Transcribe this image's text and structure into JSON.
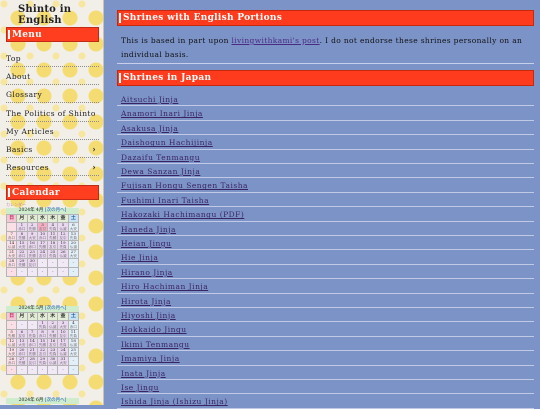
{
  "site": {
    "title": "Shinto in English"
  },
  "sidebar": {
    "menu_heading": "Menu",
    "items": [
      {
        "label": "Top"
      },
      {
        "label": "About"
      },
      {
        "label": "Glossary"
      },
      {
        "label": "The Politics of Shinto"
      },
      {
        "label": "My Articles"
      },
      {
        "label": "Basics",
        "has_submenu": true
      },
      {
        "label": "Resources",
        "has_submenu": true
      }
    ],
    "submenu_indicator": "›",
    "calendar_heading": "Calendar"
  },
  "calendar": {
    "caption": "カレンダー",
    "weekdays": [
      "日",
      "月",
      "火",
      "水",
      "木",
      "金",
      "土"
    ],
    "months": [
      {
        "title": "2024年 4月",
        "next_link": "[次の月へ]",
        "weeks": [
          [
            {
              "n": ""
            },
            {
              "n": "1",
              "s": "赤口"
            },
            {
              "n": "2",
              "s": "先勝"
            },
            {
              "n": "3",
              "s": "友引"
            },
            {
              "n": "4",
              "s": "先負"
            },
            {
              "n": "5",
              "s": "仏滅"
            },
            {
              "n": "6",
              "s": "大安"
            }
          ],
          [
            {
              "n": "7",
              "s": "赤口"
            },
            {
              "n": "8",
              "s": "先勝"
            },
            {
              "n": "9",
              "s": "大安"
            },
            {
              "n": "10",
              "s": "赤口"
            },
            {
              "n": "11",
              "s": "先勝"
            },
            {
              "n": "12",
              "s": "友引"
            },
            {
              "n": "13",
              "s": "先負"
            }
          ],
          [
            {
              "n": "14",
              "s": "仏滅"
            },
            {
              "n": "15",
              "s": "大安"
            },
            {
              "n": "16",
              "s": "赤口"
            },
            {
              "n": "17",
              "s": "先勝"
            },
            {
              "n": "18",
              "s": "友引"
            },
            {
              "n": "19",
              "s": "先負"
            },
            {
              "n": "20",
              "s": "仏滅"
            }
          ],
          [
            {
              "n": "21",
              "s": "大安"
            },
            {
              "n": "22",
              "s": "赤口"
            },
            {
              "n": "23",
              "s": "先勝"
            },
            {
              "n": "24",
              "s": "友引"
            },
            {
              "n": "25",
              "s": "先負"
            },
            {
              "n": "26",
              "s": "仏滅"
            },
            {
              "n": "27",
              "s": "大安"
            }
          ],
          [
            {
              "n": "28",
              "s": "赤口"
            },
            {
              "n": "29",
              "s": "先勝"
            },
            {
              "n": "30",
              "s": "友引"
            },
            {
              "n": "-"
            },
            {
              "n": "-"
            },
            {
              "n": "-"
            },
            {
              "n": "-"
            }
          ],
          [
            {
              "n": "-"
            },
            {
              "n": "-"
            },
            {
              "n": "-"
            },
            {
              "n": "-"
            },
            {
              "n": "-"
            },
            {
              "n": "-"
            },
            {
              "n": "-"
            }
          ]
        ]
      },
      {
        "title": "2024年 5月",
        "next_link": "[次の月へ]",
        "weeks": [
          [
            {
              "n": "-"
            },
            {
              "n": "-"
            },
            {
              "n": "-"
            },
            {
              "n": "1",
              "s": "先負"
            },
            {
              "n": "2",
              "s": "仏滅"
            },
            {
              "n": "3",
              "s": "大安"
            },
            {
              "n": "4",
              "s": "赤口"
            }
          ],
          [
            {
              "n": "5",
              "s": "先勝"
            },
            {
              "n": "6",
              "s": "友引"
            },
            {
              "n": "7",
              "s": "先負"
            },
            {
              "n": "8",
              "s": "赤口"
            },
            {
              "n": "9",
              "s": "先勝"
            },
            {
              "n": "10",
              "s": "友引"
            },
            {
              "n": "11",
              "s": "先負"
            }
          ],
          [
            {
              "n": "12",
              "s": "仏滅"
            },
            {
              "n": "13",
              "s": "大安"
            },
            {
              "n": "14",
              "s": "赤口"
            },
            {
              "n": "15",
              "s": "先勝"
            },
            {
              "n": "16",
              "s": "友引"
            },
            {
              "n": "17",
              "s": "先負"
            },
            {
              "n": "18",
              "s": "仏滅"
            }
          ],
          [
            {
              "n": "19",
              "s": "大安"
            },
            {
              "n": "20",
              "s": "赤口"
            },
            {
              "n": "21",
              "s": "先勝"
            },
            {
              "n": "22",
              "s": "友引"
            },
            {
              "n": "23",
              "s": "先負"
            },
            {
              "n": "24",
              "s": "仏滅"
            },
            {
              "n": "25",
              "s": "大安"
            }
          ],
          [
            {
              "n": "26",
              "s": "赤口"
            },
            {
              "n": "27",
              "s": "先勝"
            },
            {
              "n": "28",
              "s": "友引"
            },
            {
              "n": "29",
              "s": "先負"
            },
            {
              "n": "30",
              "s": "仏滅"
            },
            {
              "n": "31",
              "s": "大安"
            },
            {
              "n": "-"
            }
          ],
          [
            {
              "n": "-"
            },
            {
              "n": "-"
            },
            {
              "n": "-"
            },
            {
              "n": "-"
            },
            {
              "n": "-"
            },
            {
              "n": "-"
            },
            {
              "n": "-"
            }
          ]
        ]
      },
      {
        "title": "2024年 6月",
        "next_link": "[次の月へ]",
        "weeks": []
      }
    ]
  },
  "main": {
    "section1_title": "Shrines with English Portions",
    "intro_before": "This is based in part upon ",
    "intro_link": "livingwithkami's post",
    "intro_after": ". I do not endorse these shrines personally on an individual basis.",
    "section2_title": "Shrines in Japan",
    "shrines": [
      "Aitsuchi Jinja",
      "Anamori Inari Jinja",
      "Asakusa Jinja",
      "Daishogun Hachijinja",
      "Dazaifu Tenmangu",
      "Dewa Sanzan Jinja",
      "Fujisan Hongu Sengen Taisha",
      "Fushimi Inari Taisha",
      "Hakozaki Hachimangu (PDF)",
      "Haneda Jinja",
      "Heian Jingu",
      "Hie Jinja",
      "Hirano Jinja",
      "Hiro Hachiman Jinja",
      "Hirota Jinja",
      "Hiyoshi Jinja",
      "Hokkaido Jingu",
      "Ikimi Tenmangu",
      "Imamiya Jinja",
      "Inata Jinja",
      "Ise Jingu",
      "Ishida Jinja (Ishizu Jinja)"
    ]
  },
  "colors": {
    "background": "#7c93c8",
    "heading_red": "#ff3b1d",
    "sidebar_bg": "#f2efe8",
    "link": "#3a2462"
  }
}
